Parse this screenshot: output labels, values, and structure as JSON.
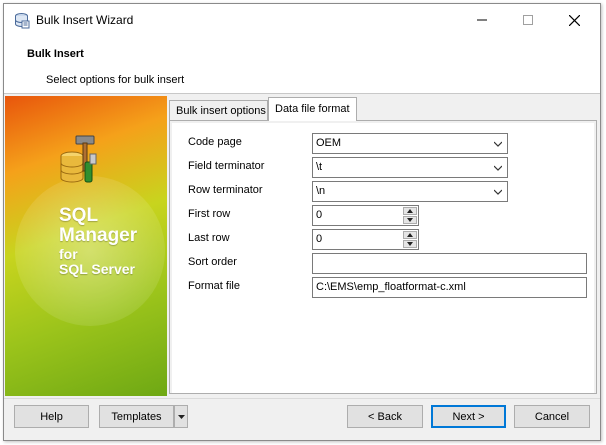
{
  "window": {
    "title": "Bulk Insert Wizard",
    "controls": {
      "minimize_icon": "minimize-icon",
      "maximize_icon": "maximize-icon",
      "close_icon": "close-icon"
    }
  },
  "header": {
    "title": "Bulk Insert",
    "subtitle": "Select options for bulk insert"
  },
  "sidebar": {
    "brand_line1": "SQL",
    "brand_line2": "Manager",
    "brand_line3": "for",
    "brand_line4": "SQL Server"
  },
  "tabs": [
    {
      "label": "Bulk insert options",
      "active": false
    },
    {
      "label": "Data file format",
      "active": true
    }
  ],
  "form": {
    "code_page": {
      "label": "Code page",
      "value": "OEM"
    },
    "field_terminator": {
      "label": "Field terminator",
      "value": "\\t"
    },
    "row_terminator": {
      "label": "Row terminator",
      "value": "\\n"
    },
    "first_row": {
      "label": "First row",
      "value": "0"
    },
    "last_row": {
      "label": "Last row",
      "value": "0"
    },
    "sort_order": {
      "label": "Sort order",
      "value": ""
    },
    "format_file": {
      "label": "Format file",
      "value": "C:\\EMS\\emp_floatformat-c.xml"
    }
  },
  "buttons": {
    "help": "Help",
    "templates": "Templates",
    "back": "< Back",
    "next": "Next >",
    "cancel": "Cancel"
  },
  "colors": {
    "accent": "#0078d7",
    "sidebar_orange": "#e8550c",
    "sidebar_green": "#6ea814"
  }
}
